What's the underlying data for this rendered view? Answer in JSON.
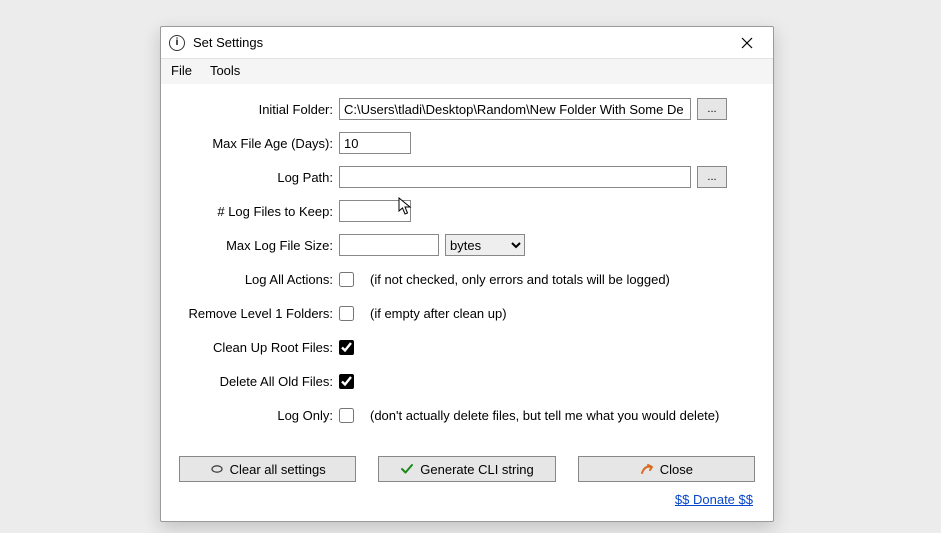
{
  "window": {
    "title": "Set Settings"
  },
  "menu": {
    "file": "File",
    "tools": "Tools"
  },
  "labels": {
    "initial_folder": "Initial Folder:",
    "max_file_age": "Max File Age (Days):",
    "log_path": "Log Path:",
    "log_files_keep": "# Log Files to Keep:",
    "max_log_size": "Max Log File Size:",
    "log_all_actions": "Log All Actions:",
    "remove_l1": "Remove Level 1 Folders:",
    "cleanup_root": "Clean Up Root Files:",
    "delete_old": "Delete All Old Files:",
    "log_only": "Log Only:"
  },
  "values": {
    "initial_folder": "C:\\Users\\tladi\\Desktop\\Random\\New Folder With Some De",
    "max_file_age": "10",
    "log_path": "",
    "log_files_keep": "",
    "max_log_size": "",
    "size_unit": "bytes"
  },
  "checks": {
    "log_all_actions": false,
    "remove_l1": false,
    "cleanup_root": true,
    "delete_old": true,
    "log_only": false
  },
  "hints": {
    "log_all_actions": "(if not checked, only errors and totals will be logged)",
    "remove_l1": "(if empty after clean up)",
    "log_only": "(don't actually delete files, but tell me what you would delete)"
  },
  "buttons": {
    "browse": "...",
    "clear": "Clear all settings",
    "generate": "Generate CLI string",
    "close": "Close"
  },
  "donate": "$$ Donate $$"
}
